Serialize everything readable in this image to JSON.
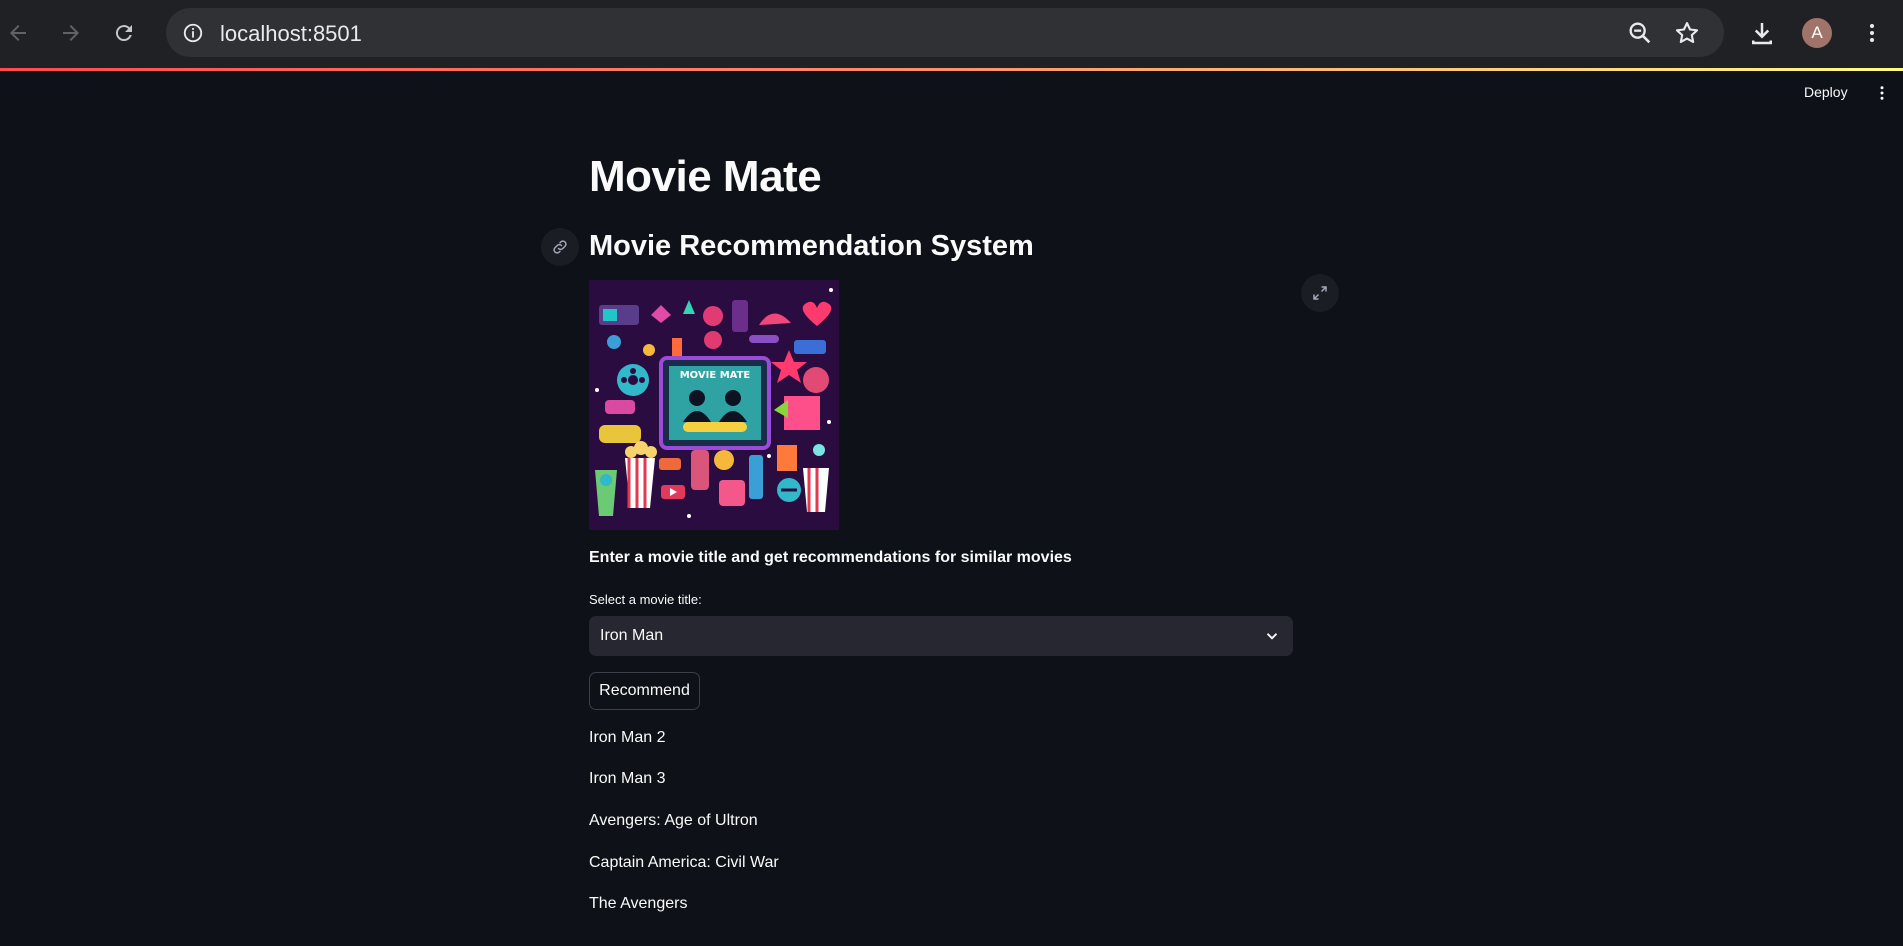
{
  "browser": {
    "url": "localhost:8501",
    "avatar_letter": "A"
  },
  "app_toolbar": {
    "deploy_label": "Deploy"
  },
  "main": {
    "title": "Movie Mate",
    "subtitle": "Movie Recommendation System",
    "poster_text": "MOVIE MATE",
    "lead": "Enter a movie title and get recommendations for similar movies",
    "select": {
      "label": "Select a movie title:",
      "value": "Iron Man"
    },
    "recommend_label": "Recommend",
    "recommendations": [
      "Iron Man 2",
      "Iron Man 3",
      "Avengers: Age of Ultron",
      "Captain America: Civil War",
      "The Avengers"
    ]
  },
  "colors": {
    "background": "#0e1117",
    "widget": "#262730",
    "chrome": "#202124",
    "accent": "#ff4b4b"
  }
}
